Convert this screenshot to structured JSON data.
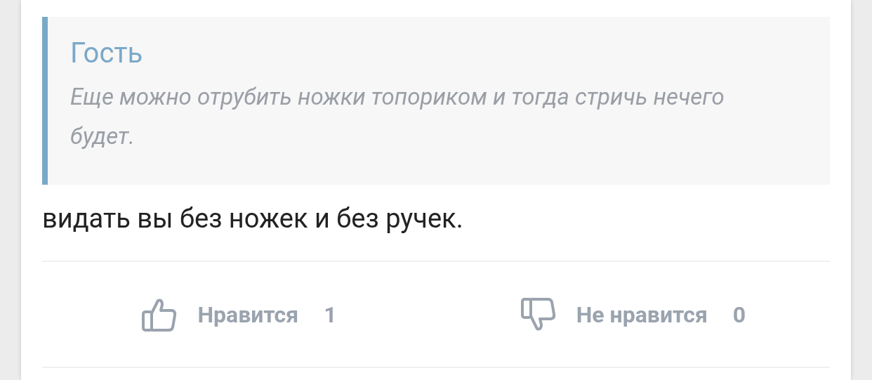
{
  "quote": {
    "author": "Гость",
    "text": "Еще можно отрубить ножки топориком и тогда стричь нечего будет."
  },
  "comment": {
    "text": "видать вы без ножек и без ручек."
  },
  "reactions": [
    {
      "kind": "like",
      "label": "Нравится",
      "count": "1"
    },
    {
      "kind": "dislike",
      "label": "Не нравится",
      "count": "0"
    }
  ]
}
